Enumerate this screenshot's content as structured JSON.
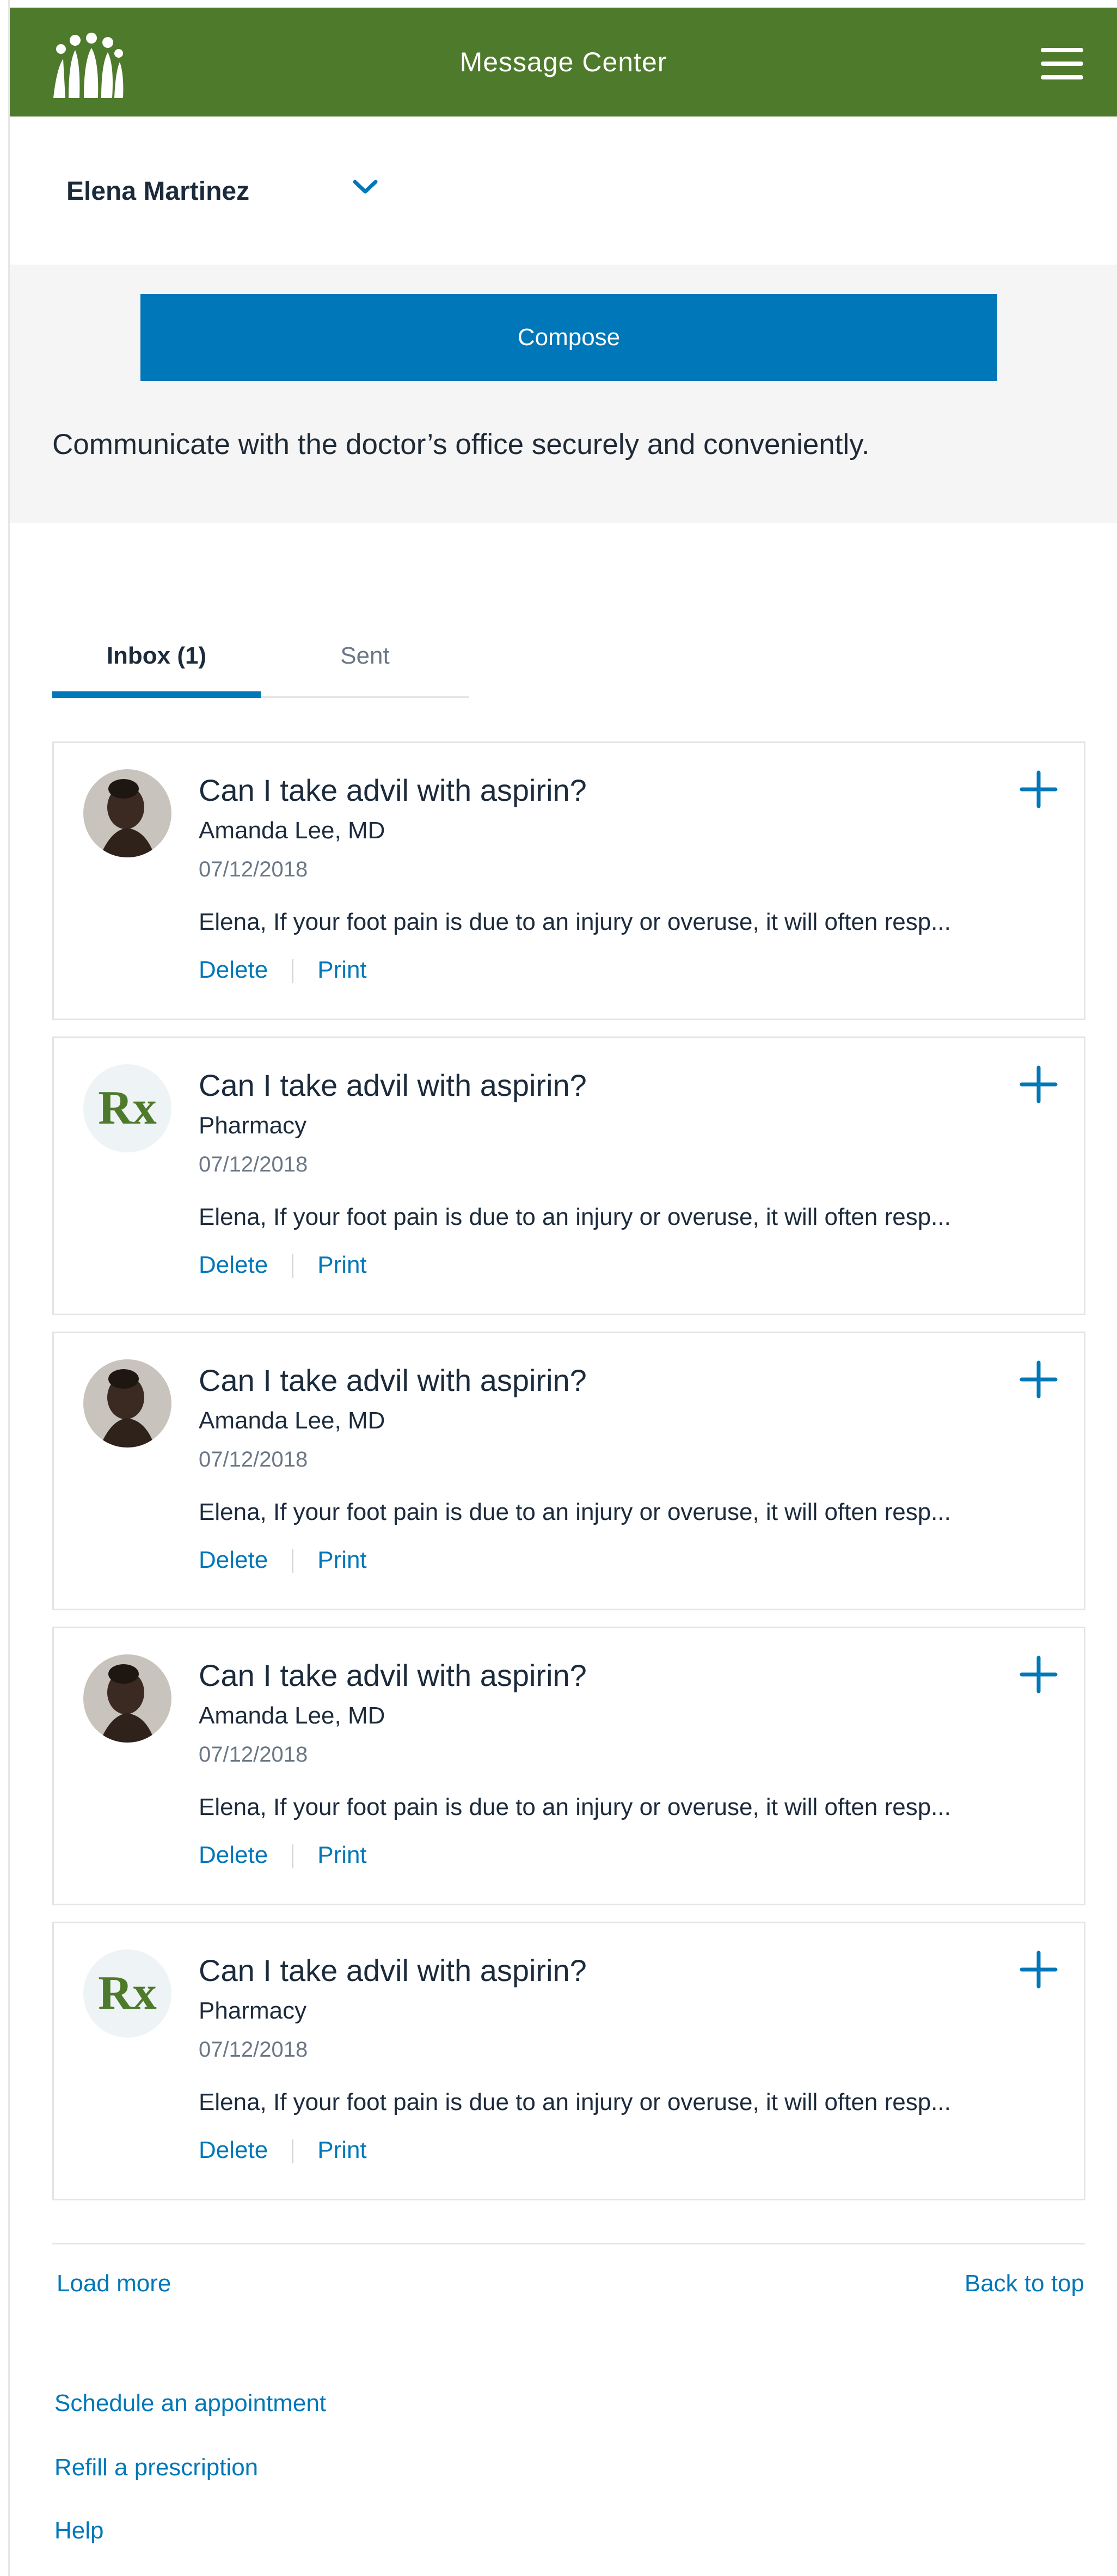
{
  "header": {
    "title": "Message Center",
    "logo_icon": "kaiser-logo-icon",
    "menu_icon": "hamburger-menu-icon",
    "color": "#4e7a2b"
  },
  "account": {
    "name": "Elena Martinez",
    "chevron_icon": "chevron-down-icon"
  },
  "compose": {
    "button_label": "Compose",
    "intro": "Communicate with the doctor’s office securely and conveniently.",
    "color": "#0077b8"
  },
  "tabs": [
    {
      "label": "Inbox (1)",
      "active": true
    },
    {
      "label": "Sent",
      "active": false
    }
  ],
  "messages": [
    {
      "subject": "Can I take advil with aspirin?",
      "sender": "Amanda Lee, MD",
      "date": "07/12/2018",
      "preview": "Elena, If your foot pain is due to an injury or overuse, it will often resp...",
      "delete_label": "Delete",
      "print_label": "Print",
      "avatar": "doctor-photo"
    },
    {
      "subject": "Can I take advil with aspirin?",
      "sender": "Pharmacy",
      "date": "07/12/2018",
      "preview": "Elena, If your foot pain is due to an injury or overuse, it will often resp...",
      "delete_label": "Delete",
      "print_label": "Print",
      "avatar": "rx-icon",
      "avatar_text": "Rx"
    },
    {
      "subject": "Can I take advil with aspirin?",
      "sender": "Amanda Lee, MD",
      "date": "07/12/2018",
      "preview": "Elena, If your foot pain is due to an injury or overuse, it will often resp...",
      "delete_label": "Delete",
      "print_label": "Print",
      "avatar": "doctor-photo"
    },
    {
      "subject": "Can I take advil with aspirin?",
      "sender": "Amanda Lee, MD",
      "date": "07/12/2018",
      "preview": "Elena, If your foot pain is due to an injury or overuse, it will often resp...",
      "delete_label": "Delete",
      "print_label": "Print",
      "avatar": "doctor-photo"
    },
    {
      "subject": "Can I take advil with aspirin?",
      "sender": "Pharmacy",
      "date": "07/12/2018",
      "preview": "Elena, If your foot pain is due to an injury or overuse, it will often resp...",
      "delete_label": "Delete",
      "print_label": "Print",
      "avatar": "rx-icon",
      "avatar_text": "Rx"
    }
  ],
  "pagination": {
    "load_more": "Load more",
    "back_to_top": "Back to top"
  },
  "footer_links": [
    "Schedule an appointment",
    "Refill a prescription",
    "Help"
  ]
}
